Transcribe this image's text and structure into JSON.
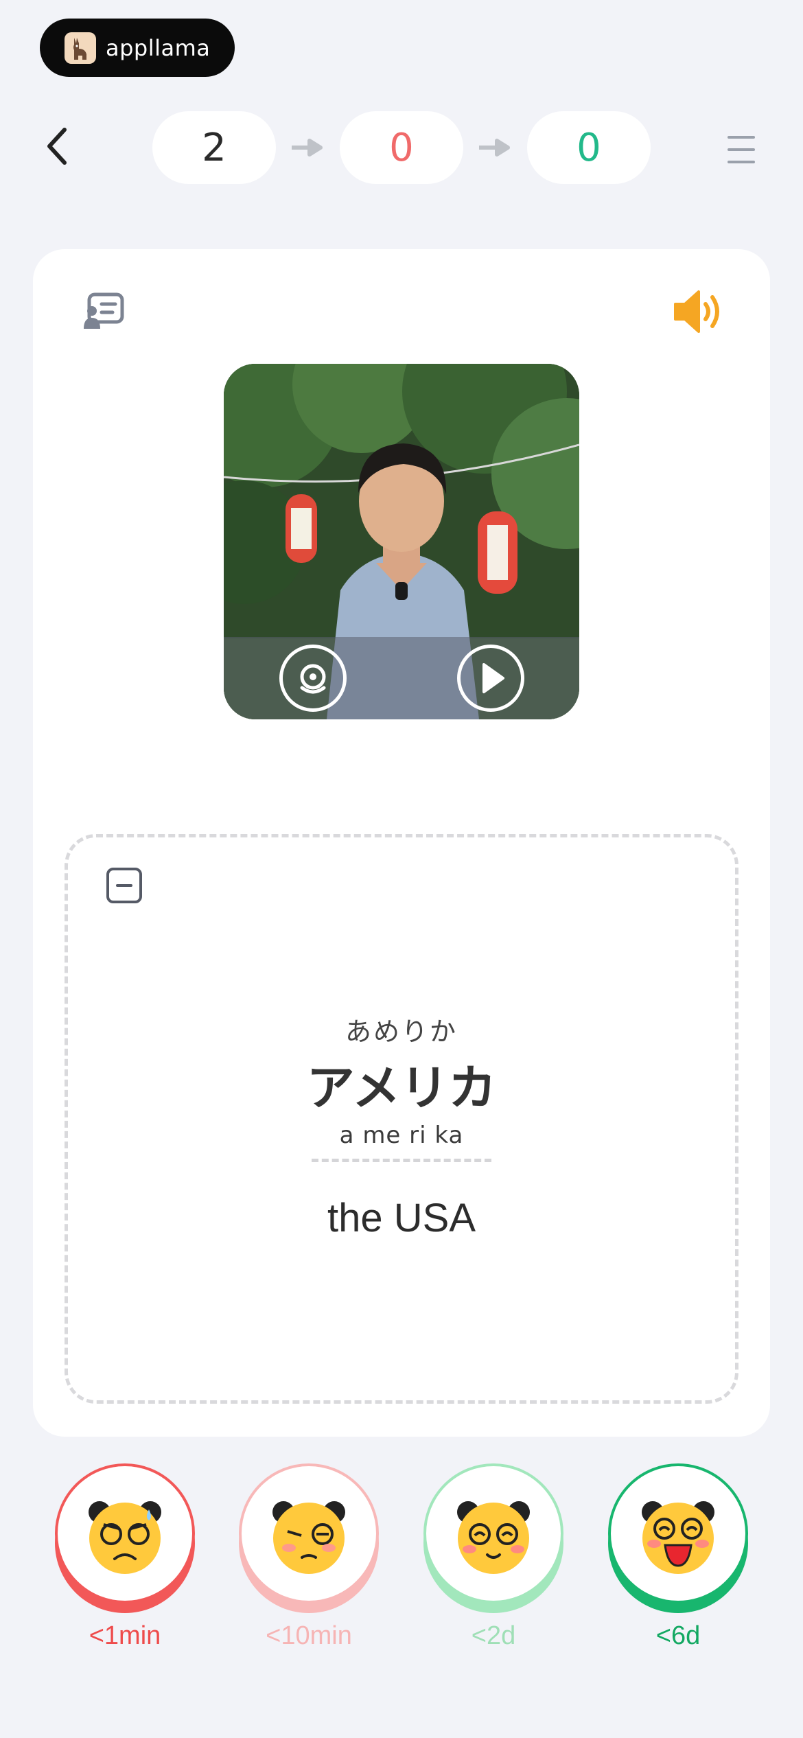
{
  "brand": {
    "name": "appllama",
    "logo_icon": "llama-logo-icon"
  },
  "nav": {
    "back_icon": "chevron-left-icon",
    "counters": {
      "total": "2",
      "wrong": "0",
      "correct": "0"
    },
    "arrow_icon": "arrow-right-icon",
    "menu_icon": "hamburger-menu-icon"
  },
  "card": {
    "info_icon": "flashcard-info-icon",
    "sound_icon": "speaker-icon",
    "video": {
      "replay_icon": "replay-slow-icon",
      "play_icon": "play-icon"
    },
    "answer": {
      "collapse_icon": "collapse-minus-icon",
      "furigana": "あめりか",
      "word": "アメリカ",
      "romaji": "a me ri ka",
      "meaning": "the USA"
    }
  },
  "ratings": [
    {
      "label": "<1min",
      "face": "sweating-frown-face-icon",
      "color": "#f25858"
    },
    {
      "label": "<10min",
      "face": "pouting-face-icon",
      "color": "#f8b8b8"
    },
    {
      "label": "<2d",
      "face": "smiling-wink-face-icon",
      "color": "#a2e7bc"
    },
    {
      "label": "<6d",
      "face": "laughing-face-icon",
      "color": "#18b66e"
    }
  ],
  "colors": {
    "background": "#f2f3f8",
    "accent_sound": "#f5a623",
    "wrong": "#f06a6a",
    "correct": "#22b98a"
  }
}
